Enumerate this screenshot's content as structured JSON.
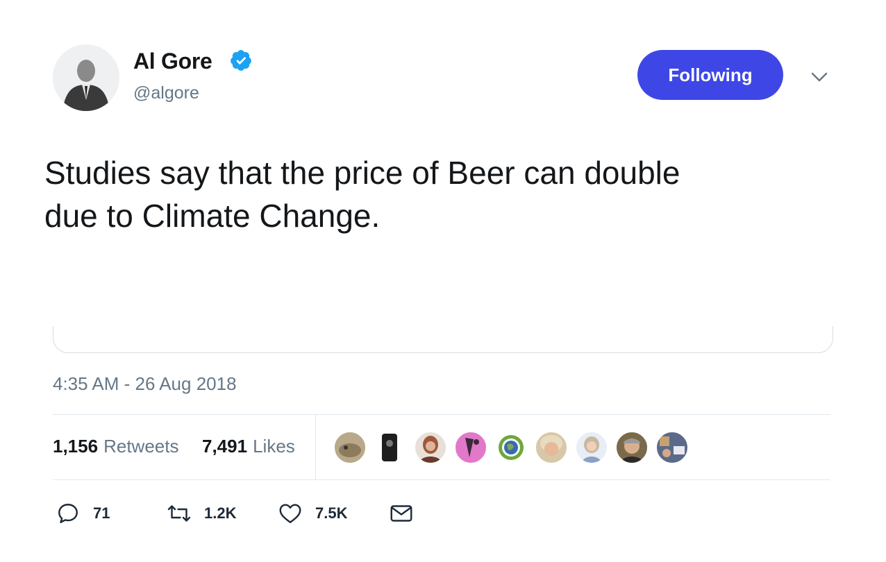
{
  "tweet": {
    "author": {
      "display_name": "Al Gore",
      "handle": "@algore",
      "verified_icon": "verified-badge-icon",
      "avatar_icon": "profile-photo"
    },
    "follow_button": {
      "label": "Following",
      "color": "#3e47e6"
    },
    "menu_icon": "chevron-down-icon",
    "text_line_1": "Studies say that the price of Beer can double",
    "text_line_2": "due to Climate Change.",
    "timestamp": "4:35 AM - 26 Aug 2018",
    "stats": {
      "retweets_count": "1,156",
      "retweets_label": "Retweets",
      "likes_count": "7,491",
      "likes_label": "Likes"
    },
    "likers": [
      {
        "icon": "liker-avatar-1",
        "color": "#b9a98a"
      },
      {
        "icon": "liker-avatar-2",
        "color": "#2b2b2b"
      },
      {
        "icon": "liker-avatar-3",
        "color": "#9c5a3a"
      },
      {
        "icon": "liker-avatar-4",
        "color": "#e278c8"
      },
      {
        "icon": "liker-avatar-5",
        "color": "#6da83a"
      },
      {
        "icon": "liker-avatar-6",
        "color": "#c8b28a"
      },
      {
        "icon": "liker-avatar-7",
        "color": "#b8c4d6"
      },
      {
        "icon": "liker-avatar-8",
        "color": "#7a6a4a"
      },
      {
        "icon": "liker-avatar-9",
        "color": "#5a6a8a"
      }
    ],
    "actions": {
      "reply_count": "71",
      "retweet_count": "1.2K",
      "like_count": "7.5K",
      "reply_icon": "reply-icon",
      "retweet_icon": "retweet-icon",
      "like_icon": "heart-icon",
      "dm_icon": "envelope-icon"
    }
  }
}
